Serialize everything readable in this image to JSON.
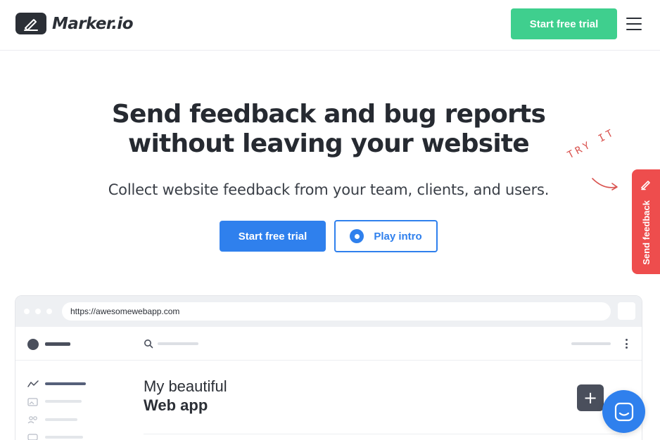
{
  "header": {
    "brand": "Marker.io",
    "cta_label": "Start free trial"
  },
  "hero": {
    "title_line1": "Send feedback and bug reports",
    "title_line2": "without leaving your website",
    "subtitle": "Collect website feedback from your team, clients, and users.",
    "primary_cta": "Start free trial",
    "secondary_cta": "Play intro",
    "annotation": "TRY IT"
  },
  "feedback_tab": {
    "label": "Send feedback",
    "icon": "pencil-icon"
  },
  "browser_mock": {
    "url": "https://awesomewebapp.com",
    "heading_line1": "My beautiful",
    "heading_line2": "Web app",
    "add_button_label": "+"
  },
  "chat": {
    "icon": "chat-smile-icon"
  },
  "colors": {
    "green_cta": "#3fcf8e",
    "blue_primary": "#2f80ed",
    "feedback_red": "#ee4d4d",
    "dark_text": "#262a31"
  }
}
